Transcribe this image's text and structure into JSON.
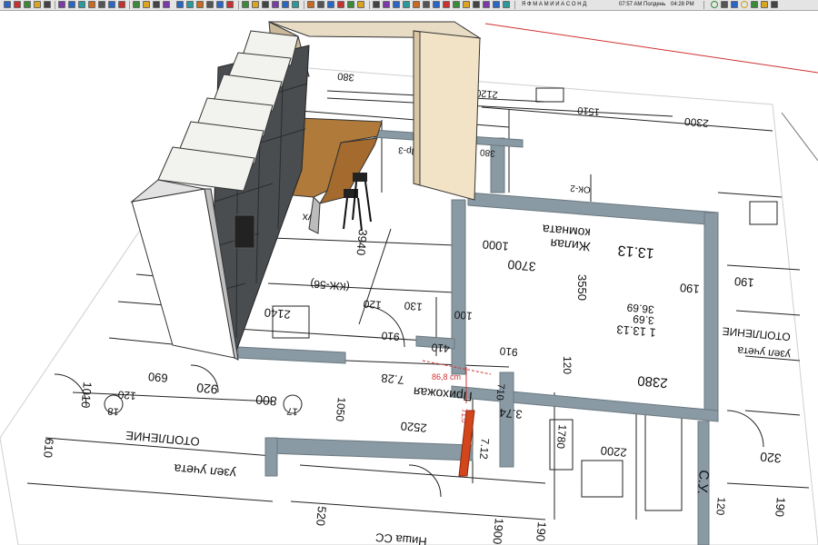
{
  "toolbar": {
    "icon_colors": [
      "#2a66c4",
      "#c93030",
      "#3a8a3a",
      "#d9a520",
      "#444444",
      "#7a3aa8",
      "#2a66c4",
      "#2a9a9a",
      "#c96a20",
      "#555555"
    ],
    "shadow_months": "Я Ф М А М И И А С О Н Д",
    "time_start": "07:57 AM",
    "noon": "Полдень",
    "time_end": "04:28 PM"
  },
  "dimension": {
    "distance": "86,8 cm",
    "small": "71,0"
  },
  "plan": {
    "top": [
      "2120",
      "1510",
      "2300",
      "380",
      "380"
    ],
    "living": [
      "13.13",
      "Жилая",
      "комната",
      "3700",
      "1000",
      "3550",
      "1 13.13",
      "36.69",
      "3.69",
      "190",
      "2380",
      "120",
      "910"
    ],
    "kitchen": [
      "(КЖ-56)",
      "2140",
      "3940",
      "120",
      "130",
      "410",
      "910",
      "100",
      "Кух"
    ],
    "hall": [
      "Прихожая",
      "7.28",
      "2520",
      "1050",
      "ОК-2",
      "Пр-3"
    ],
    "bath": [
      "С.У.",
      "3.74",
      "2200",
      "1780",
      "7.12",
      "710"
    ],
    "left": [
      "920",
      "690",
      "800",
      "1010",
      "610",
      "120",
      "18",
      "17",
      "ОТОПЛЕНИЕ",
      "узел учета",
      "Ниша СС",
      "520",
      "1900",
      "190"
    ],
    "right": [
      "190",
      "ОТОПЛЕНИЕ",
      "узел учета",
      "320",
      "190",
      "120"
    ]
  }
}
